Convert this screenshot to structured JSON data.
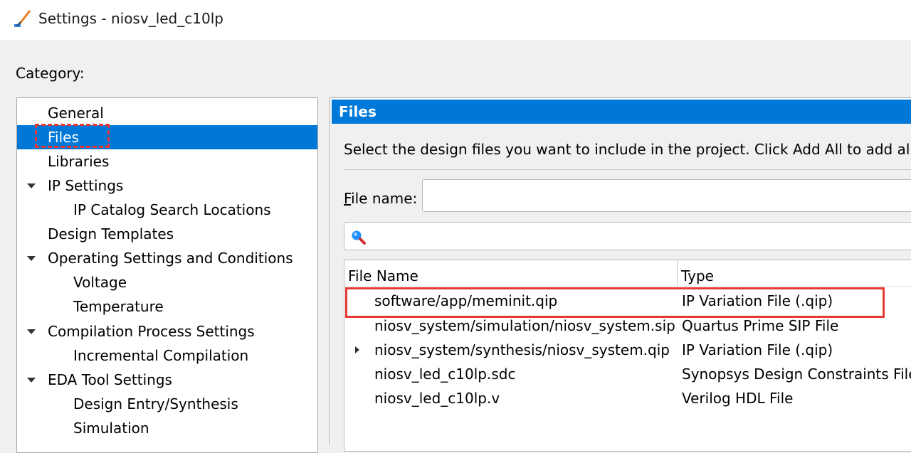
{
  "window": {
    "title": "Settings - niosv_led_c10lp",
    "icon": "settings-wand-icon"
  },
  "category": {
    "label": "Category:",
    "items": [
      {
        "label": "General",
        "level": 0,
        "expandable": false,
        "selected": false
      },
      {
        "label": "Files",
        "level": 0,
        "expandable": false,
        "selected": true
      },
      {
        "label": "Libraries",
        "level": 0,
        "expandable": false,
        "selected": false
      },
      {
        "label": "IP Settings",
        "level": 0,
        "expandable": true,
        "selected": false
      },
      {
        "label": "IP Catalog Search Locations",
        "level": 1,
        "expandable": false,
        "selected": false
      },
      {
        "label": "Design Templates",
        "level": 0,
        "expandable": false,
        "selected": false
      },
      {
        "label": "Operating Settings and Conditions",
        "level": 0,
        "expandable": true,
        "selected": false
      },
      {
        "label": "Voltage",
        "level": 1,
        "expandable": false,
        "selected": false
      },
      {
        "label": "Temperature",
        "level": 1,
        "expandable": false,
        "selected": false
      },
      {
        "label": "Compilation Process Settings",
        "level": 0,
        "expandable": true,
        "selected": false
      },
      {
        "label": "Incremental Compilation",
        "level": 1,
        "expandable": false,
        "selected": false
      },
      {
        "label": "EDA Tool Settings",
        "level": 0,
        "expandable": true,
        "selected": false
      },
      {
        "label": "Design Entry/Synthesis",
        "level": 1,
        "expandable": false,
        "selected": false
      },
      {
        "label": "Simulation",
        "level": 1,
        "expandable": false,
        "selected": false
      }
    ]
  },
  "files_panel": {
    "header": "Files",
    "instructions": "Select the design files you want to include in the project. Click Add All to add all des",
    "file_name_label_mnemonic": "F",
    "file_name_label_rest": "ile name:",
    "file_name_value": "",
    "search_value": "",
    "columns": [
      "File Name",
      "Type"
    ],
    "rows": [
      {
        "name": "software/app/meminit.qip",
        "type": "IP Variation File (.qip)",
        "expandable": false
      },
      {
        "name": "niosv_system/simulation/niosv_system.sip",
        "type": "Quartus Prime SIP File",
        "expandable": false
      },
      {
        "name": "niosv_system/synthesis/niosv_system.qip",
        "type": "IP Variation File (.qip)",
        "expandable": true
      },
      {
        "name": "niosv_led_c10lp.sdc",
        "type": "Synopsys Design Constraints File",
        "expandable": false
      },
      {
        "name": "niosv_led_c10lp.v",
        "type": "Verilog HDL File",
        "expandable": false
      }
    ]
  },
  "colors": {
    "selection": "#0078d7",
    "annotation": "#e53935"
  }
}
